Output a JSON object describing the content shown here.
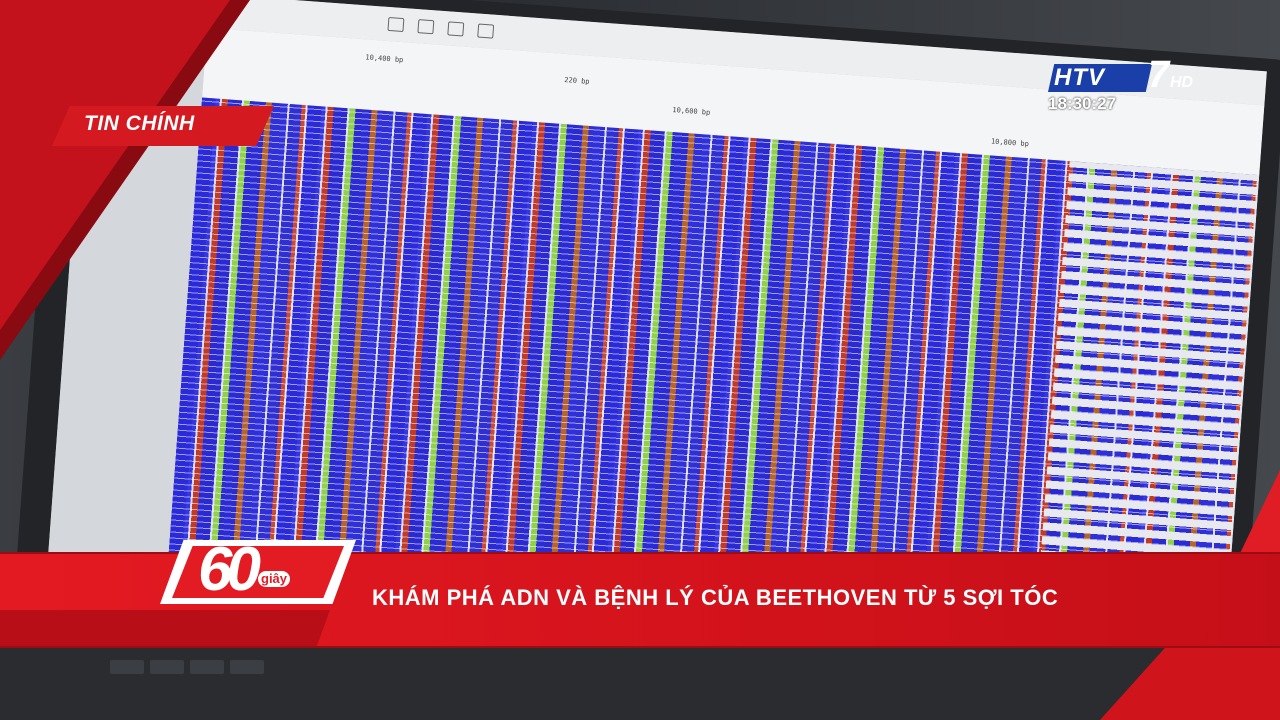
{
  "broadcast": {
    "section_label": "TIN CHÍNH",
    "channel_logo": "HTV",
    "channel_number": "7",
    "channel_suffix": "HD",
    "clock": "18:30:27",
    "program_badge_number": "60",
    "program_badge_word": "giây",
    "headline": "KHÁM PHÁ ADN VÀ BỆNH LÝ CỦA BEETHOVEN TỪ 5 SỢI TÓC"
  },
  "screen": {
    "ruler_labels": [
      "10,400 bp",
      "220 bp",
      "10,600 bp",
      "10,800 bp"
    ]
  },
  "colors": {
    "overlay_red": "#e41a22",
    "logo_blue": "#1a3fa8",
    "read_blue": "#2a2ad8",
    "read_green": "#8fd14a",
    "read_red": "#c03a2a",
    "read_orange": "#b5642d"
  }
}
